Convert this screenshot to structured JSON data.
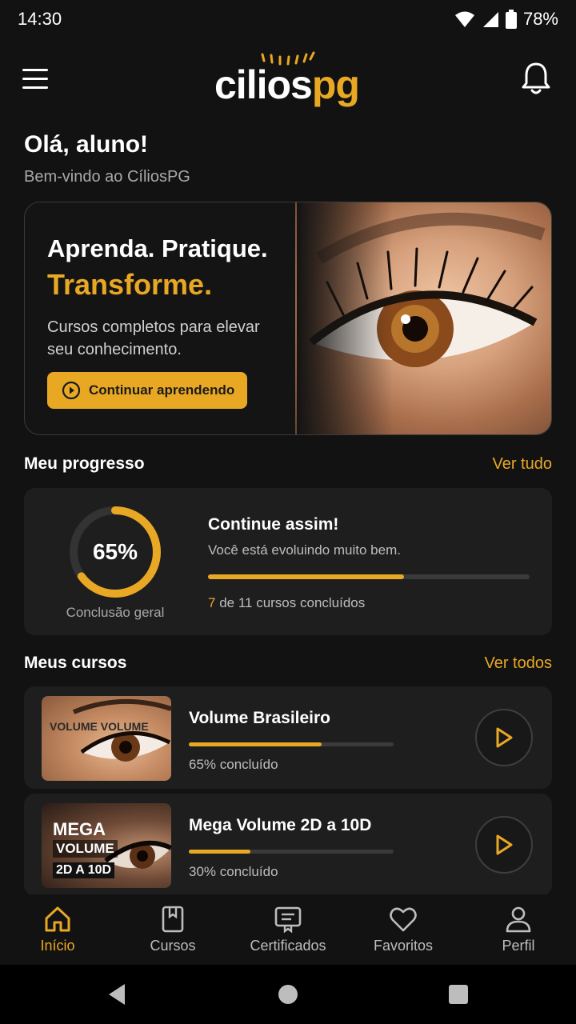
{
  "status_bar": {
    "time": "14:30",
    "battery": "78%"
  },
  "header": {
    "logo_main": "cilios",
    "logo_accent": "pg"
  },
  "greeting": {
    "title": "Olá, aluno!",
    "subtitle": "Bem-vindo ao CíliosPG"
  },
  "hero": {
    "line1": "Aprenda. Pratique.",
    "line2": "Transforme.",
    "description": "Cursos completos para elevar seu conhecimento.",
    "button_label": "Continuar aprendendo"
  },
  "progress_section": {
    "title": "Meu progresso",
    "link": "Ver tudo",
    "overall_percent": 0.65,
    "percent_label": "65%",
    "ring_caption": "Conclusão geral",
    "card_title": "Continue assim!",
    "card_subtitle": "Você está evoluindo muito bem.",
    "bar_fraction": 0.61,
    "completed": "7",
    "completed_text": " de 11 cursos concluídos"
  },
  "courses_section": {
    "title": "Meus cursos",
    "link": "Ver todos",
    "items": [
      {
        "title": "Volume Brasileiro",
        "progress": 0.65,
        "progress_label": "65% concluído",
        "thumb_text": "VOLUME VOLUME"
      },
      {
        "title": "Mega Volume 2D a 10D",
        "progress": 0.3,
        "progress_label": "30% concluído",
        "thumb_mega": "MEGA",
        "thumb_volume": "VOLUME",
        "thumb_range": "2D A 10D"
      }
    ]
  },
  "bottom_nav": [
    {
      "label": "Início",
      "icon": "home-icon",
      "active": true
    },
    {
      "label": "Cursos",
      "icon": "book-icon",
      "active": false
    },
    {
      "label": "Certificados",
      "icon": "certificate-icon",
      "active": false
    },
    {
      "label": "Favoritos",
      "icon": "heart-icon",
      "active": false
    },
    {
      "label": "Perfil",
      "icon": "user-icon",
      "active": false
    }
  ],
  "colors": {
    "accent": "#e8a824",
    "background": "#121212",
    "card": "#1e1e1e"
  }
}
